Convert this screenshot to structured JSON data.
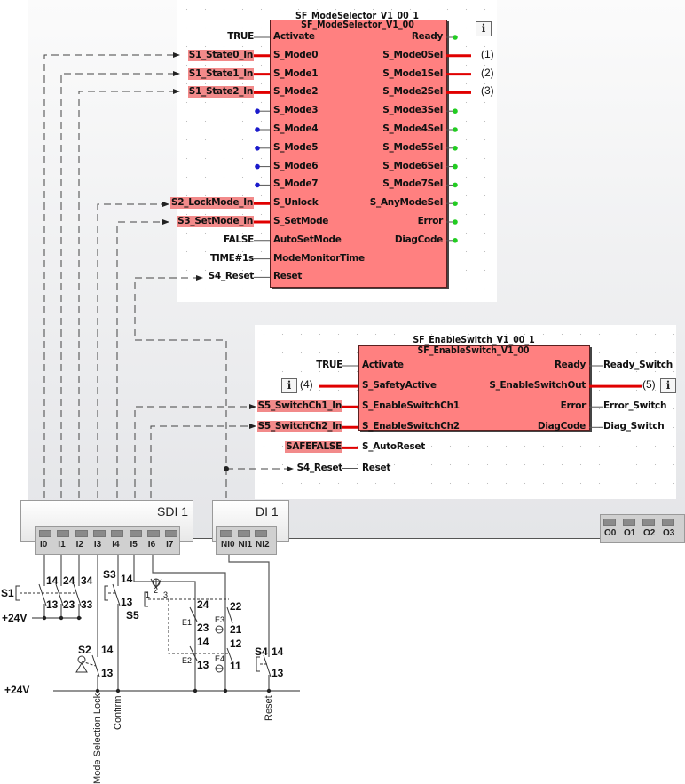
{
  "mode_selector": {
    "instance_name": "SF_ModeSelector_V1_00_1",
    "type_name": "SF_ModeSelector_V1_00",
    "inputs": [
      {
        "pin": "Activate",
        "value": "TRUE",
        "safe": false
      },
      {
        "pin": "S_Mode0",
        "value": "S1_State0_In",
        "safe": true
      },
      {
        "pin": "S_Mode1",
        "value": "S1_State1_In",
        "safe": true
      },
      {
        "pin": "S_Mode2",
        "value": "S1_State2_In",
        "safe": true
      },
      {
        "pin": "S_Mode3",
        "value": "",
        "safe": false
      },
      {
        "pin": "S_Mode4",
        "value": "",
        "safe": false
      },
      {
        "pin": "S_Mode5",
        "value": "",
        "safe": false
      },
      {
        "pin": "S_Mode6",
        "value": "",
        "safe": false
      },
      {
        "pin": "S_Mode7",
        "value": "",
        "safe": false
      },
      {
        "pin": "S_Unlock",
        "value": "S2_LockMode_In",
        "safe": true
      },
      {
        "pin": "S_SetMode",
        "value": "S3_SetMode_In",
        "safe": true
      },
      {
        "pin": "AutoSetMode",
        "value": "FALSE",
        "safe": false
      },
      {
        "pin": "ModeMonitorTime",
        "value": "TIME#1s",
        "safe": false
      },
      {
        "pin": "Reset",
        "value": "S4_Reset",
        "safe": false
      }
    ],
    "outputs": [
      {
        "pin": "Ready",
        "value": ""
      },
      {
        "pin": "S_Mode0Sel",
        "value": "(1)"
      },
      {
        "pin": "S_Mode1Sel",
        "value": "(2)"
      },
      {
        "pin": "S_Mode2Sel",
        "value": "(3)"
      },
      {
        "pin": "S_Mode3Sel",
        "value": ""
      },
      {
        "pin": "S_Mode4Sel",
        "value": ""
      },
      {
        "pin": "S_Mode5Sel",
        "value": ""
      },
      {
        "pin": "S_Mode6Sel",
        "value": ""
      },
      {
        "pin": "S_Mode7Sel",
        "value": ""
      },
      {
        "pin": "S_AnyModeSel",
        "value": ""
      },
      {
        "pin": "Error",
        "value": ""
      },
      {
        "pin": "DiagCode",
        "value": ""
      }
    ],
    "info_icon": "i"
  },
  "enable_switch": {
    "instance_name": "SF_EnableSwitch_V1_00_1",
    "type_name": "SF_EnableSwitch_V1_00",
    "inputs": [
      {
        "pin": "Activate",
        "value": "TRUE",
        "safe": false
      },
      {
        "pin": "S_SafetyActive",
        "value": "(4)",
        "safe": false
      },
      {
        "pin": "S_EnableSwitchCh1",
        "value": "S5_SwitchCh1_In",
        "safe": true
      },
      {
        "pin": "S_EnableSwitchCh2",
        "value": "S5_SwitchCh2_In",
        "safe": true
      },
      {
        "pin": "S_AutoReset",
        "value": "SAFEFALSE",
        "safe": true
      },
      {
        "pin": "Reset",
        "value": "S4_Reset",
        "safe": false
      }
    ],
    "outputs": [
      {
        "pin": "Ready",
        "value": "Ready_Switch"
      },
      {
        "pin": "S_EnableSwitchOut",
        "value": "(5)"
      },
      {
        "pin": "Error",
        "value": "Error_Switch"
      },
      {
        "pin": "DiagCode",
        "value": "Diag_Switch"
      }
    ],
    "info_icon": "i"
  },
  "modules": {
    "sdi": {
      "label": "SDI 1",
      "terminals": [
        "I0",
        "I1",
        "I2",
        "I3",
        "I4",
        "I5",
        "I6",
        "I7"
      ]
    },
    "di": {
      "label": "DI 1",
      "terminals": [
        "NI0",
        "NI1",
        "NI2"
      ]
    },
    "dout": {
      "terminals": [
        "O0",
        "O1",
        "O2",
        "O3"
      ]
    }
  },
  "wiring": {
    "supply_1": "+24V",
    "supply_2": "+24V",
    "s1": {
      "name": "S1",
      "contacts": [
        "14",
        "24",
        "34",
        "13",
        "23",
        "33"
      ]
    },
    "s2": {
      "name": "S2",
      "contacts": [
        "14",
        "13"
      ]
    },
    "s3": {
      "name": "S3",
      "contacts": [
        "14",
        "13"
      ]
    },
    "s4": {
      "name": "S4",
      "contacts": [
        "14",
        "13"
      ]
    },
    "s5": {
      "name": "S5",
      "positions": [
        "1",
        "2",
        "3"
      ],
      "contacts": [
        "24",
        "23",
        "14",
        "13",
        "22",
        "21",
        "12",
        "11"
      ],
      "elements": [
        "E1",
        "E2",
        "E3",
        "E4"
      ]
    },
    "signal_labels": [
      "Mode Selection Lock",
      "Confirm",
      "Reset"
    ]
  },
  "colors": {
    "fb_fill": "#ff8080",
    "safe_wire": "#e00000",
    "safe_var_bg": "#f28a8a",
    "input_dot": "#1a1acc",
    "output_dot": "#22cc22"
  }
}
